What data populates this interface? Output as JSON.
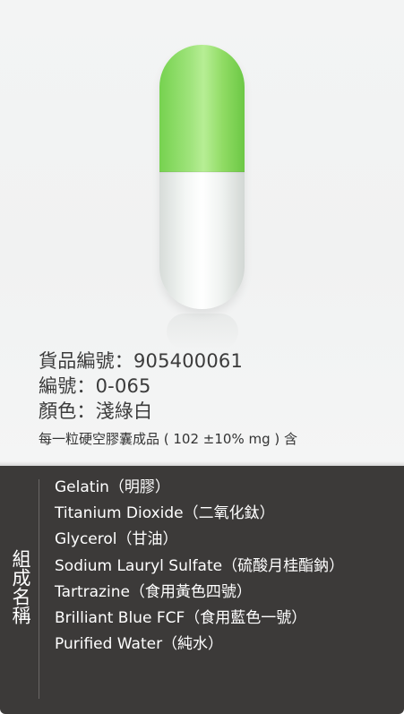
{
  "product": {
    "item_no": "貨品編號：905400061",
    "code": "編號：0-065",
    "color": "顏色：淺綠白",
    "note": "每一粒硬空膠囊成品 ( 102 ±10% mg ) 含"
  },
  "capsule": {
    "top_color": "#8edc63",
    "bottom_color": "#f4f6f5"
  },
  "composition": {
    "label": "組成名稱",
    "ingredients": [
      "Gelatin（明膠）",
      "Titanium Dioxide（二氧化鈦）",
      "Glycerol（甘油）",
      "Sodium Lauryl Sulfate（硫酸月桂酯鈉）",
      "Tartrazine（食用黃色四號）",
      "Brilliant Blue FCF（食用藍色一號）",
      "Purified Water（純水）"
    ]
  }
}
